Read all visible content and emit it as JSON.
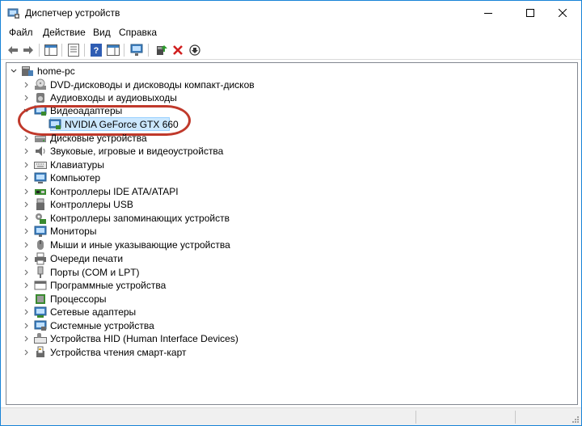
{
  "window": {
    "title": "Диспетчер устройств",
    "accent": "#1883d7"
  },
  "menu": {
    "items": [
      "Файл",
      "Действие",
      "Вид",
      "Справка"
    ]
  },
  "toolbar": {
    "icons": [
      "back-icon",
      "forward-icon",
      "show-hide-console-tree-icon",
      "properties-icon",
      "help-icon",
      "action-pane-icon",
      "monitor-icon",
      "update-driver-icon",
      "uninstall-icon",
      "disable-icon"
    ]
  },
  "tree": {
    "root": "home-pc",
    "categories": [
      {
        "label": "DVD-дисководы и дисководы компакт-дисков",
        "icon": "dvd-drive-icon",
        "expanded": false
      },
      {
        "label": "Аудиовходы и аудиовыходы",
        "icon": "audio-io-icon",
        "expanded": false
      },
      {
        "label": "Видеоадаптеры",
        "icon": "display-adapter-icon",
        "expanded": true,
        "children": [
          "NVIDIA GeForce GTX 660"
        ]
      },
      {
        "label": "Дисковые устройства",
        "icon": "disk-drive-icon",
        "expanded": false
      },
      {
        "label": "Звуковые, игровые и видеоустройства",
        "icon": "speaker-icon",
        "expanded": false
      },
      {
        "label": "Клавиатуры",
        "icon": "keyboard-icon",
        "expanded": false
      },
      {
        "label": "Компьютер",
        "icon": "computer-icon",
        "expanded": false
      },
      {
        "label": "Контроллеры IDE ATA/ATAPI",
        "icon": "ide-controller-icon",
        "expanded": false
      },
      {
        "label": "Контроллеры USB",
        "icon": "usb-controller-icon",
        "expanded": false
      },
      {
        "label": "Контроллеры запоминающих устройств",
        "icon": "storage-controller-icon",
        "expanded": false
      },
      {
        "label": "Мониторы",
        "icon": "monitor-icon",
        "expanded": false
      },
      {
        "label": "Мыши и иные указывающие устройства",
        "icon": "mouse-icon",
        "expanded": false
      },
      {
        "label": "Очереди печати",
        "icon": "printer-icon",
        "expanded": false
      },
      {
        "label": "Порты (COM и LPT)",
        "icon": "port-icon",
        "expanded": false
      },
      {
        "label": "Программные устройства",
        "icon": "software-device-icon",
        "expanded": false
      },
      {
        "label": "Процессоры",
        "icon": "processor-icon",
        "expanded": false
      },
      {
        "label": "Сетевые адаптеры",
        "icon": "network-adapter-icon",
        "expanded": false
      },
      {
        "label": "Системные устройства",
        "icon": "system-device-icon",
        "expanded": false
      },
      {
        "label": "Устройства HID (Human Interface Devices)",
        "icon": "hid-icon",
        "expanded": false
      },
      {
        "label": "Устройства чтения смарт-карт",
        "icon": "smart-card-reader-icon",
        "expanded": false
      }
    ],
    "selected_color": "#cce8ff",
    "highlight_ring_color": "#c0392b"
  }
}
